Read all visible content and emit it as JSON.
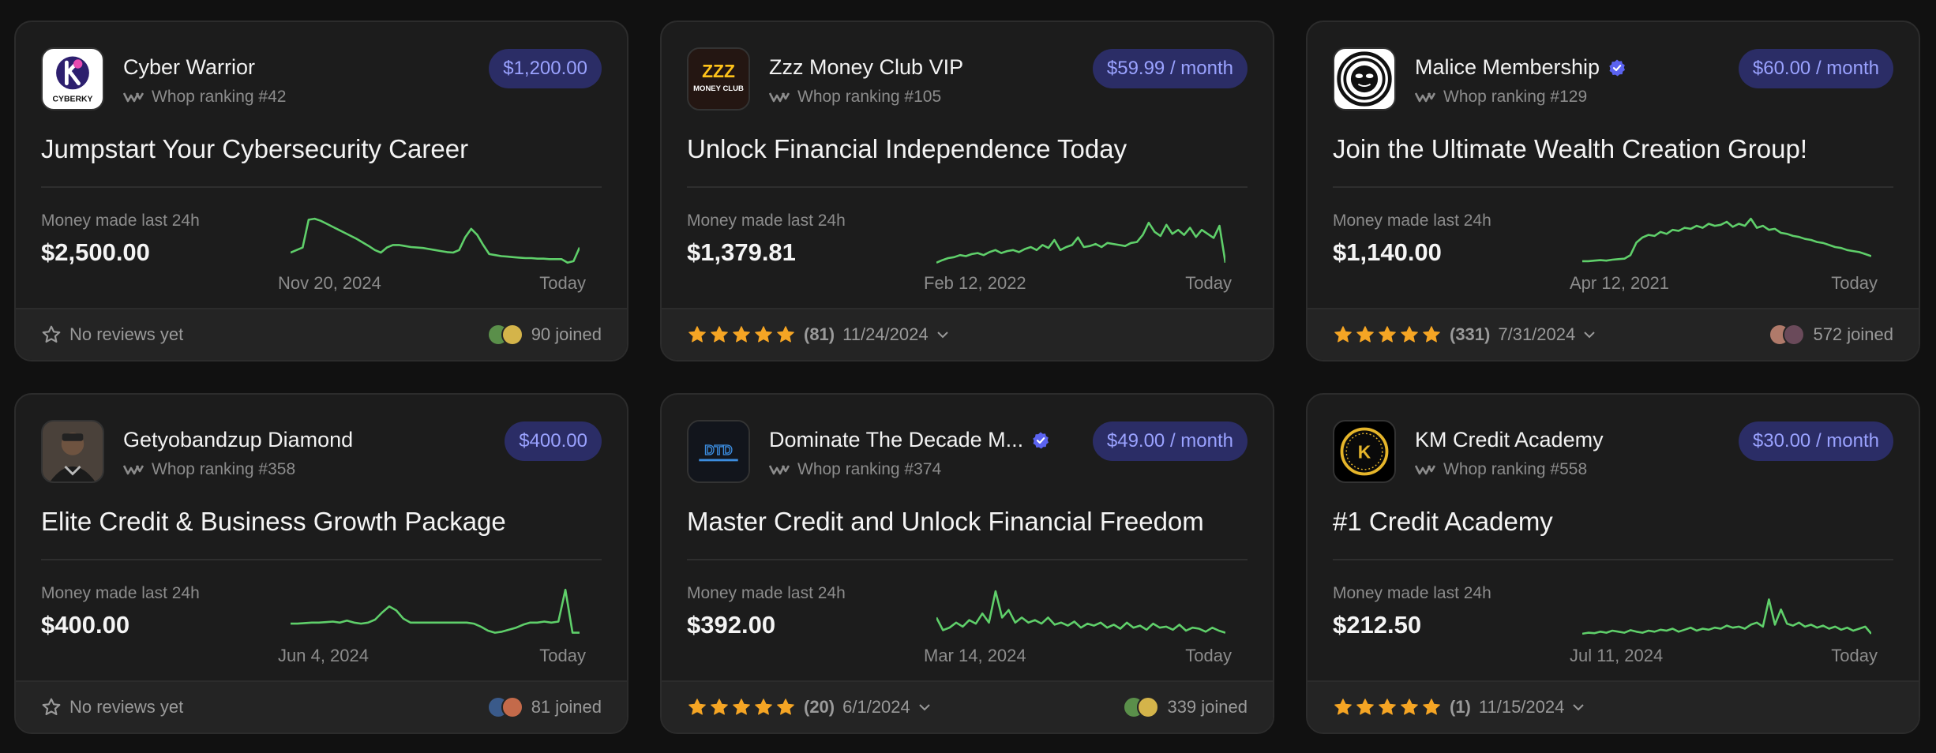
{
  "cards": [
    {
      "name": "Cyber Warrior",
      "verified": false,
      "ranking": "Whop ranking #42",
      "price": "$1,200.00",
      "headline": "Jumpstart Your Cybersecurity Career",
      "money_label": "Money made last 24h",
      "money": "$2,500.00",
      "date_start": "Nov 20, 2024",
      "date_end": "Today",
      "reviews": {
        "has_reviews": false,
        "text": "No reviews yet",
        "count": "",
        "date": ""
      },
      "joined": "90 joined",
      "logo": {
        "type": "cyberky",
        "text": "CYBERKY",
        "letter": "K"
      },
      "spark": [
        0.25,
        0.3,
        0.35,
        0.9,
        0.92,
        0.88,
        0.82,
        0.76,
        0.7,
        0.64,
        0.58,
        0.52,
        0.45,
        0.38,
        0.3,
        0.25,
        0.35,
        0.4,
        0.4,
        0.38,
        0.36,
        0.35,
        0.34,
        0.32,
        0.3,
        0.28,
        0.26,
        0.25,
        0.3,
        0.55,
        0.72,
        0.6,
        0.4,
        0.22,
        0.2,
        0.18,
        0.17,
        0.16,
        0.15,
        0.14,
        0.14,
        0.13,
        0.13,
        0.12,
        0.12,
        0.12,
        0.05,
        0.08,
        0.35
      ]
    },
    {
      "name": "Zzz Money Club VIP",
      "verified": false,
      "ranking": "Whop ranking #105",
      "price": "$59.99 / month",
      "headline": "Unlock Financial Independence Today",
      "money_label": "Money made last 24h",
      "money": "$1,379.81",
      "date_start": "Feb 12, 2022",
      "date_end": "Today",
      "reviews": {
        "has_reviews": true,
        "text": "",
        "count": "(81)",
        "date": "11/24/2024"
      },
      "joined": "",
      "logo": {
        "type": "zzz",
        "text": "MONEY CLUB",
        "letter": "ZZZ"
      },
      "spark": [
        0.05,
        0.1,
        0.14,
        0.16,
        0.2,
        0.18,
        0.22,
        0.24,
        0.2,
        0.26,
        0.3,
        0.24,
        0.28,
        0.3,
        0.26,
        0.32,
        0.36,
        0.3,
        0.4,
        0.34,
        0.5,
        0.3,
        0.36,
        0.4,
        0.55,
        0.36,
        0.38,
        0.42,
        0.36,
        0.44,
        0.42,
        0.4,
        0.38,
        0.44,
        0.46,
        0.6,
        0.84,
        0.66,
        0.58,
        0.8,
        0.62,
        0.7,
        0.6,
        0.74,
        0.56,
        0.7,
        0.62,
        0.54,
        0.78,
        0.05
      ]
    },
    {
      "name": "Malice Membership",
      "verified": true,
      "ranking": "Whop ranking #129",
      "price": "$60.00 / month",
      "headline": "Join the Ultimate Wealth Creation Group!",
      "money_label": "Money made last 24h",
      "money": "$1,140.00",
      "date_start": "Apr 12, 2021",
      "date_end": "Today",
      "reviews": {
        "has_reviews": true,
        "text": "",
        "count": "(331)",
        "date": "7/31/2024"
      },
      "joined": "572 joined",
      "logo": {
        "type": "malice",
        "text": "",
        "letter": ""
      },
      "spark": [
        0.08,
        0.08,
        0.09,
        0.1,
        0.09,
        0.11,
        0.12,
        0.13,
        0.2,
        0.45,
        0.55,
        0.6,
        0.58,
        0.66,
        0.62,
        0.7,
        0.68,
        0.74,
        0.72,
        0.78,
        0.74,
        0.82,
        0.78,
        0.8,
        0.86,
        0.76,
        0.82,
        0.78,
        0.92,
        0.74,
        0.78,
        0.7,
        0.72,
        0.64,
        0.62,
        0.58,
        0.56,
        0.52,
        0.5,
        0.46,
        0.44,
        0.4,
        0.36,
        0.34,
        0.3,
        0.28,
        0.26,
        0.22,
        0.18
      ]
    },
    {
      "name": "Getyobandzup Diamond",
      "verified": false,
      "ranking": "Whop ranking #358",
      "price": "$400.00",
      "headline": "Elite Credit & Business Growth Package",
      "money_label": "Money made last 24h",
      "money": "$400.00",
      "date_start": "Jun 4, 2024",
      "date_end": "Today",
      "reviews": {
        "has_reviews": false,
        "text": "No reviews yet",
        "count": "",
        "date": ""
      },
      "joined": "81 joined",
      "logo": {
        "type": "photo",
        "text": "",
        "letter": ""
      },
      "spark": [
        0.28,
        0.28,
        0.29,
        0.3,
        0.3,
        0.31,
        0.32,
        0.3,
        0.34,
        0.3,
        0.28,
        0.3,
        0.36,
        0.5,
        0.62,
        0.54,
        0.38,
        0.3,
        0.3,
        0.3,
        0.3,
        0.3,
        0.3,
        0.3,
        0.3,
        0.3,
        0.28,
        0.22,
        0.14,
        0.1,
        0.12,
        0.16,
        0.2,
        0.26,
        0.3,
        0.3,
        0.32,
        0.3,
        0.32,
        0.95,
        0.1,
        0.1
      ]
    },
    {
      "name": "Dominate The Decade M...",
      "verified": true,
      "ranking": "Whop ranking #374",
      "price": "$49.00 / month",
      "headline": "Master Credit and Unlock Financial Freedom",
      "money_label": "Money made last 24h",
      "money": "$392.00",
      "date_start": "Mar 14, 2024",
      "date_end": "Today",
      "reviews": {
        "has_reviews": true,
        "text": "",
        "count": "(20)",
        "date": "6/1/2024"
      },
      "joined": "339 joined",
      "logo": {
        "type": "dtd",
        "text": "DTD",
        "letter": ""
      },
      "spark": [
        0.4,
        0.15,
        0.2,
        0.3,
        0.22,
        0.35,
        0.28,
        0.48,
        0.3,
        0.92,
        0.4,
        0.55,
        0.3,
        0.4,
        0.3,
        0.35,
        0.28,
        0.4,
        0.26,
        0.3,
        0.24,
        0.32,
        0.2,
        0.28,
        0.24,
        0.3,
        0.2,
        0.26,
        0.18,
        0.3,
        0.2,
        0.24,
        0.16,
        0.28,
        0.2,
        0.22,
        0.16,
        0.26,
        0.14,
        0.2,
        0.18,
        0.12,
        0.2,
        0.14,
        0.1
      ]
    },
    {
      "name": "KM Credit Academy",
      "verified": false,
      "ranking": "Whop ranking #558",
      "price": "$30.00 / month",
      "headline": "#1 Credit Academy",
      "money_label": "Money made last 24h",
      "money": "$212.50",
      "date_start": "Jul 11, 2024",
      "date_end": "Today",
      "reviews": {
        "has_reviews": true,
        "text": "",
        "count": "(1)",
        "date": "11/15/2024"
      },
      "joined": "",
      "logo": {
        "type": "km",
        "text": "K",
        "letter": "K"
      },
      "spark": [
        0.08,
        0.1,
        0.09,
        0.12,
        0.1,
        0.14,
        0.12,
        0.1,
        0.15,
        0.12,
        0.1,
        0.14,
        0.12,
        0.16,
        0.14,
        0.18,
        0.12,
        0.16,
        0.2,
        0.14,
        0.18,
        0.16,
        0.2,
        0.18,
        0.24,
        0.2,
        0.22,
        0.18,
        0.26,
        0.3,
        0.22,
        0.76,
        0.26,
        0.56,
        0.28,
        0.24,
        0.3,
        0.22,
        0.26,
        0.2,
        0.24,
        0.18,
        0.22,
        0.16,
        0.2,
        0.14,
        0.18,
        0.22,
        0.08
      ]
    }
  ],
  "colors": {
    "accent": "#9aa2ff",
    "price_bg": "#2b2d66",
    "spark": "#5fcf6a",
    "star": "#f5a524",
    "verified": "#5b63f0"
  }
}
